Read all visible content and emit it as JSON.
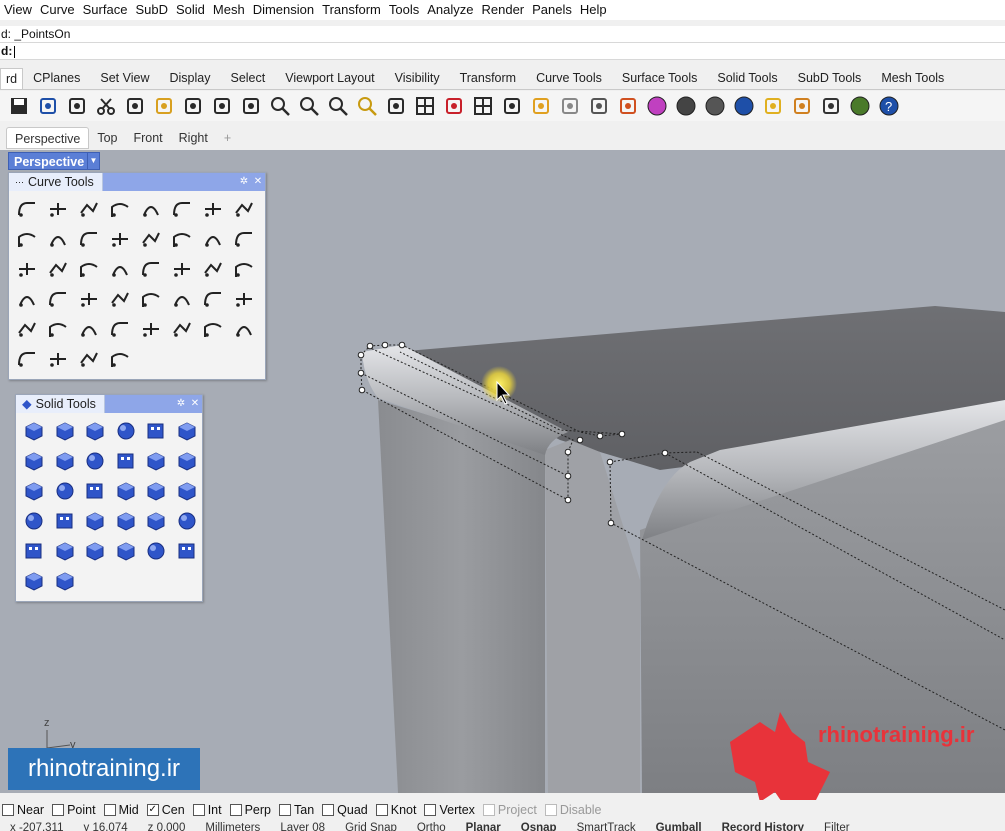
{
  "menu": [
    "View",
    "Curve",
    "Surface",
    "SubD",
    "Solid",
    "Mesh",
    "Dimension",
    "Transform",
    "Tools",
    "Analyze",
    "Render",
    "Panels",
    "Help"
  ],
  "command": {
    "history": "d: _PointsOn",
    "prompt": "d:"
  },
  "tabs": {
    "items": [
      "rd",
      "CPlanes",
      "Set View",
      "Display",
      "Select",
      "Viewport Layout",
      "Visibility",
      "Transform",
      "Curve Tools",
      "Surface Tools",
      "Solid Tools",
      "SubD Tools",
      "Mesh Tools"
    ],
    "active": 0
  },
  "toolbar_icons": [
    "save-icon",
    "print-icon",
    "new-page-icon",
    "cut-icon",
    "copy-icon",
    "paste-icon",
    "undo-icon",
    "pan-icon",
    "rotate-icon",
    "zoom-icon",
    "zoom-window-icon",
    "zoom-extents-icon",
    "zoom-selected-icon",
    "rotate-view-icon",
    "four-viewports-icon",
    "car-icon",
    "grid-icon",
    "point-icon",
    "osnap-icon",
    "light-icon",
    "lock-icon",
    "layers-icon",
    "color-wheel-icon",
    "render-sphere-icon",
    "material-sphere-icon",
    "blue-sphere-icon",
    "lamp-icon",
    "gear-icon",
    "dimension-icon",
    "globe-icon",
    "help-icon"
  ],
  "viewport_tabs": {
    "items": [
      "Perspective",
      "Top",
      "Front",
      "Right"
    ],
    "active": 0,
    "add": "+"
  },
  "viewport": {
    "label": "Perspective",
    "bg": "#a7acb5"
  },
  "curve_tools": {
    "title": "Curve Tools",
    "icon_count": 44
  },
  "solid_tools": {
    "title": "Solid Tools",
    "icon_count": 32
  },
  "axes": {
    "z": "z",
    "y": "y"
  },
  "watermark": "rhinotraining.ir",
  "logo_text": "rhinotraining.ir",
  "colors": {
    "accent": "#5b7fd6",
    "watermark_bg": "#2d73b8",
    "logo": "#e8333a",
    "viewport_bg": "#a7acb5",
    "solid_blue": "#2f55c9"
  },
  "osnaps": [
    {
      "label": "Near",
      "checked": false,
      "disabled": false
    },
    {
      "label": "Point",
      "checked": false,
      "disabled": false
    },
    {
      "label": "Mid",
      "checked": false,
      "disabled": false
    },
    {
      "label": "Cen",
      "checked": true,
      "disabled": false
    },
    {
      "label": "Int",
      "checked": false,
      "disabled": false
    },
    {
      "label": "Perp",
      "checked": false,
      "disabled": false
    },
    {
      "label": "Tan",
      "checked": false,
      "disabled": false
    },
    {
      "label": "Quad",
      "checked": false,
      "disabled": false
    },
    {
      "label": "Knot",
      "checked": false,
      "disabled": false
    },
    {
      "label": "Vertex",
      "checked": false,
      "disabled": false
    },
    {
      "label": "Project",
      "checked": false,
      "disabled": true
    },
    {
      "label": "Disable",
      "checked": false,
      "disabled": true
    }
  ],
  "status": {
    "x": "x -207.311",
    "y": "y 16.074",
    "z": "z 0.000",
    "units": "Millimeters",
    "layer": "Layer 08",
    "items": [
      "Grid Snap",
      "Ortho",
      "Planar",
      "Osnap",
      "SmartTrack",
      "Gumball",
      "Record History",
      "Filter"
    ],
    "bold": [
      "Planar",
      "Osnap",
      "Gumball",
      "Record History"
    ]
  }
}
